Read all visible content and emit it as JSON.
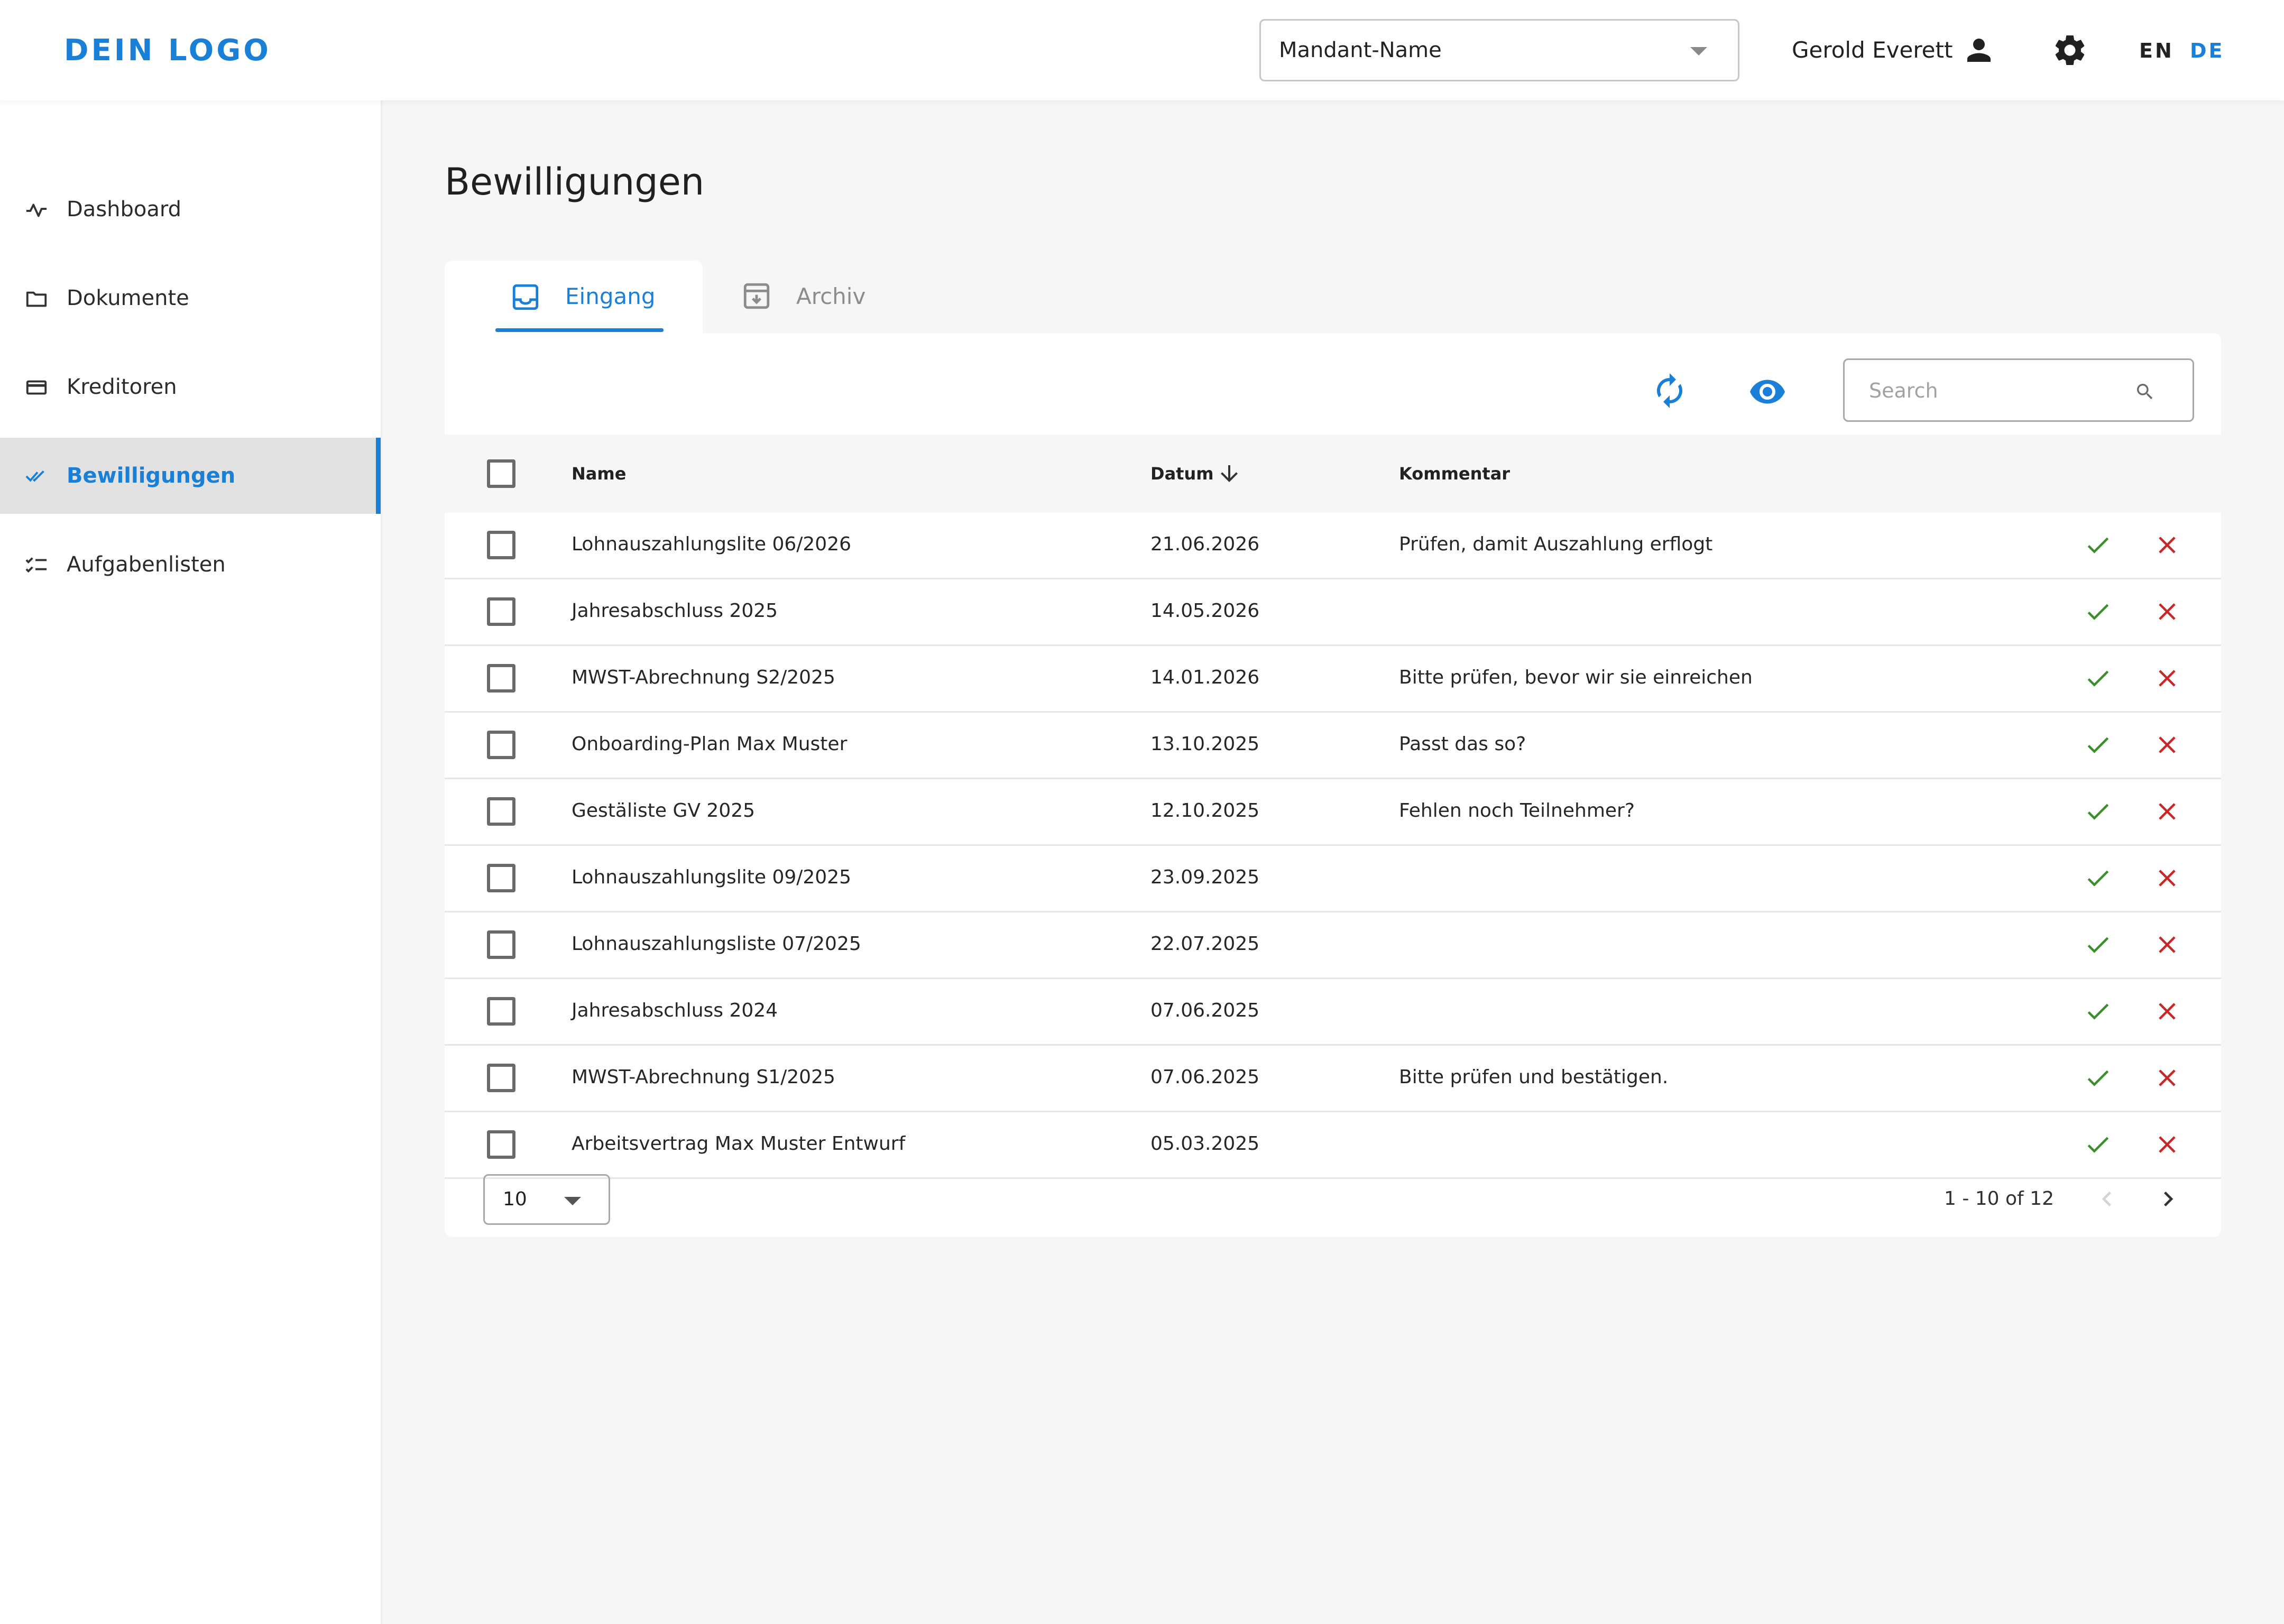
{
  "header": {
    "logo": "DEIN LOGO",
    "tenant_select": "Mandant-Name",
    "user_name": "Gerold Everett",
    "lang_en": "EN",
    "lang_de": "DE",
    "active_lang": "DE",
    "accent_color": "#1a7fd6"
  },
  "sidebar": {
    "items": [
      {
        "label": "Dashboard",
        "icon": "activity-icon"
      },
      {
        "label": "Dokumente",
        "icon": "folder-icon"
      },
      {
        "label": "Kreditoren",
        "icon": "credit-card-icon"
      },
      {
        "label": "Bewilligungen",
        "icon": "double-check-icon",
        "active": true
      },
      {
        "label": "Aufgabenlisten",
        "icon": "checklist-icon"
      }
    ]
  },
  "page": {
    "title": "Bewilligungen",
    "tabs": [
      {
        "label": "Eingang",
        "icon": "inbox-icon",
        "active": true
      },
      {
        "label": "Archiv",
        "icon": "archive-icon"
      }
    ],
    "search_placeholder": "Search"
  },
  "table": {
    "columns": {
      "name": "Name",
      "date": "Datum",
      "comment": "Kommentar"
    },
    "sort": {
      "column": "Datum",
      "direction": "desc"
    },
    "rows": [
      {
        "name": "Lohnauszahlungslite 06/2026",
        "date": "21.06.2026",
        "comment": "Prüfen, damit Auszahlung erflogt"
      },
      {
        "name": "Jahresabschluss 2025",
        "date": "14.05.2026",
        "comment": ""
      },
      {
        "name": "MWST-Abrechnung S2/2025",
        "date": "14.01.2026",
        "comment": "Bitte prüfen, bevor wir sie einreichen"
      },
      {
        "name": "Onboarding-Plan Max Muster",
        "date": "13.10.2025",
        "comment": "Passt das so?"
      },
      {
        "name": "Gestäliste GV 2025",
        "date": "12.10.2025",
        "comment": "Fehlen noch Teilnehmer?"
      },
      {
        "name": "Lohnauszahlungslite 09/2025",
        "date": "23.09.2025",
        "comment": ""
      },
      {
        "name": "Lohnauszahlungsliste 07/2025",
        "date": "22.07.2025",
        "comment": ""
      },
      {
        "name": "Jahresabschluss 2024",
        "date": "07.06.2025",
        "comment": ""
      },
      {
        "name": "MWST-Abrechnung S1/2025",
        "date": "07.06.2025",
        "comment": "Bitte prüfen und bestätigen."
      },
      {
        "name": "Arbeitsvertrag Max Muster Entwurf",
        "date": "05.03.2025",
        "comment": ""
      }
    ],
    "approve_color": "#3a8f2a",
    "reject_color": "#c62828"
  },
  "pagination": {
    "page_size": "10",
    "range": "1 - 10 of 12"
  }
}
